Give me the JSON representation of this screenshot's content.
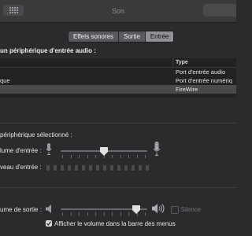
{
  "window": {
    "title": "Son"
  },
  "tabs": [
    {
      "label": "Effets sonores",
      "active": false
    },
    {
      "label": "Sortie",
      "active": false
    },
    {
      "label": "Entrée",
      "active": true
    }
  ],
  "input_devices": {
    "heading": "un périphérique d'entrée audio :",
    "column_type": "Type",
    "rows": [
      {
        "name": "",
        "type": "Port d'entrée audio",
        "selected": false
      },
      {
        "name": "que",
        "type": "Port d'entrée numériq",
        "selected": false
      },
      {
        "name": "",
        "type": "FireWire",
        "selected": true
      }
    ]
  },
  "selected_device": {
    "heading": "périphérique sélectionné :",
    "input_volume_label": "lume d'entrée :",
    "input_volume_level": 0.5,
    "input_level_label": "veau d'entrée :",
    "input_level_segments": 15,
    "input_level_active": 0
  },
  "output": {
    "volume_label": "ume de sortie :",
    "volume_level": 0.87,
    "mute_label": "Silence",
    "mute_checked": false,
    "show_in_menubar_label": "Afficher le volume dans la barre des menus",
    "show_in_menubar_checked": true
  },
  "colors": {
    "accent": "#909095",
    "background": "#2b2b2d",
    "selected_row": "#4a4a4d"
  }
}
